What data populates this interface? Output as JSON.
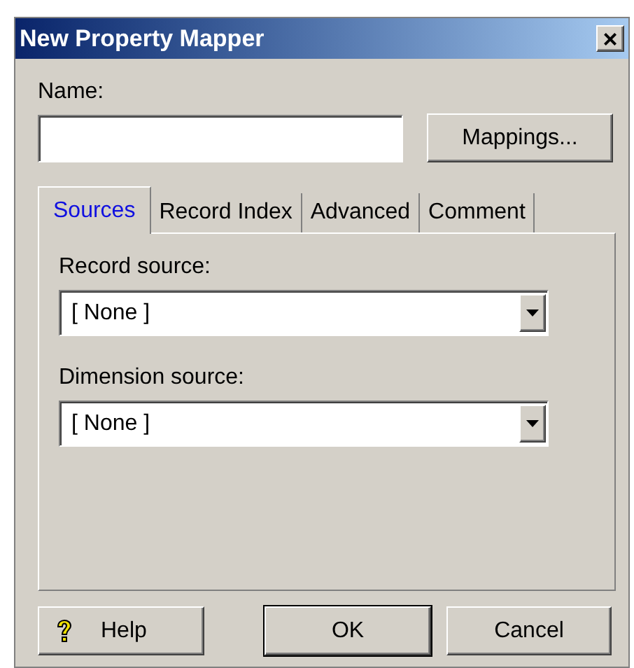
{
  "window": {
    "title": "New Property Mapper",
    "close": "×"
  },
  "name_field": {
    "label": "Name:"
  },
  "mappings_button": "Mappings...",
  "tabs": [
    {
      "label": "Sources",
      "selected": true
    },
    {
      "label": "Record Index",
      "selected": false
    },
    {
      "label": "Advanced",
      "selected": false
    },
    {
      "label": "Comment",
      "selected": false
    }
  ],
  "sources": [
    {
      "label": "Record source:",
      "value": "[ None ]"
    },
    {
      "label": "Dimension source:",
      "value": "[ None ]"
    }
  ],
  "buttons": [
    {
      "kind": "help",
      "label": "Help"
    },
    {
      "kind": "default",
      "label": "OK"
    },
    {
      "kind": "plain",
      "label": "Cancel"
    }
  ]
}
